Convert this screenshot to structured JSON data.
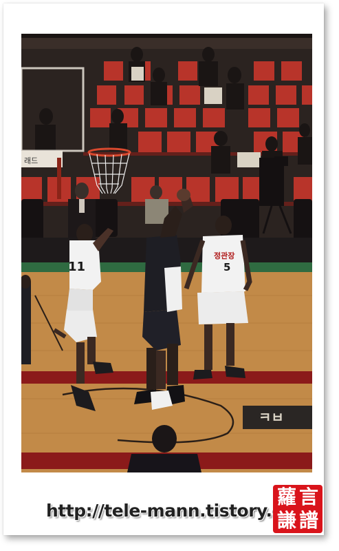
{
  "watermark": {
    "url_text": "http://tele-mann.tistory.com"
  },
  "seal": {
    "characters": [
      "蘿",
      "言",
      "謙",
      "譜"
    ],
    "color": "#d9141b"
  },
  "photo": {
    "subject": "basketball-game",
    "jerseys": {
      "left_player_number": "11",
      "right_player_number": "5",
      "right_player_chest_text": "정관장"
    },
    "backboard_sign": "래드",
    "court_logo_text": "ㅋㅂ"
  },
  "colors": {
    "seats": "#c0392b",
    "court_wood": "#c28a48",
    "court_line": "#8b1a1a",
    "jersey_white": "#f2f2f2",
    "jersey_dark": "#1e1e24"
  }
}
